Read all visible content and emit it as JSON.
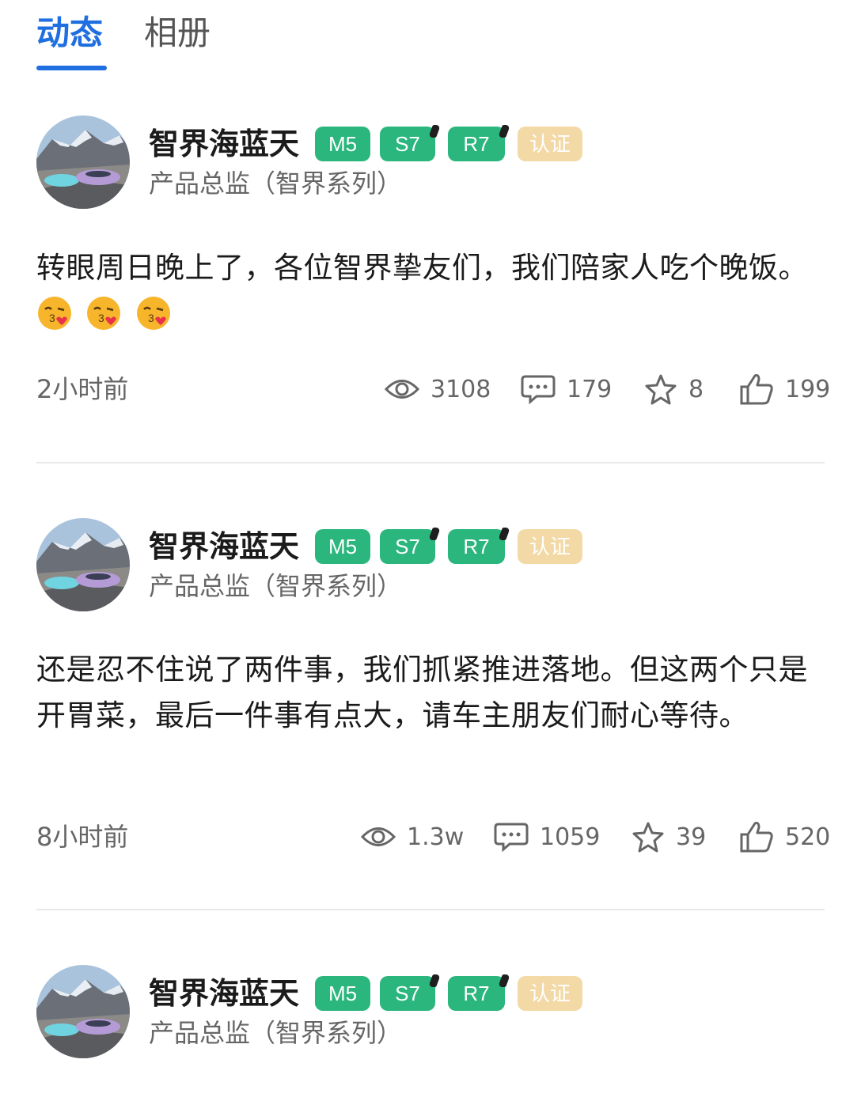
{
  "tabs": {
    "active": "动态",
    "inactive": "相册"
  },
  "author": {
    "name": "智界海蓝天",
    "role": "产品总监（智界系列）",
    "badges": [
      "M5",
      "S7",
      "R7",
      "认证"
    ]
  },
  "colors": {
    "accent": "#1f6fe0",
    "badge_green": "#2ab67d",
    "badge_gold": "#f3d9a6"
  },
  "posts": [
    {
      "content": "转眼周日晚上了，各位智界挚友们，我们陪家人吃个晚饭。",
      "emoji": "kissing-face-with-heart-emoji",
      "emoji_count": 3,
      "time": "2小时前",
      "views": "3108",
      "comments": "179",
      "favorites": "8",
      "likes": "199"
    },
    {
      "content": "还是忍不住说了两件事，我们抓紧推进落地。但这两个只是开胃菜，最后一件事有点大，请车主朋友们耐心等待。",
      "time": "8小时前",
      "views": "1.3w",
      "comments": "1059",
      "favorites": "39",
      "likes": "520"
    },
    {
      "content": ""
    }
  ]
}
